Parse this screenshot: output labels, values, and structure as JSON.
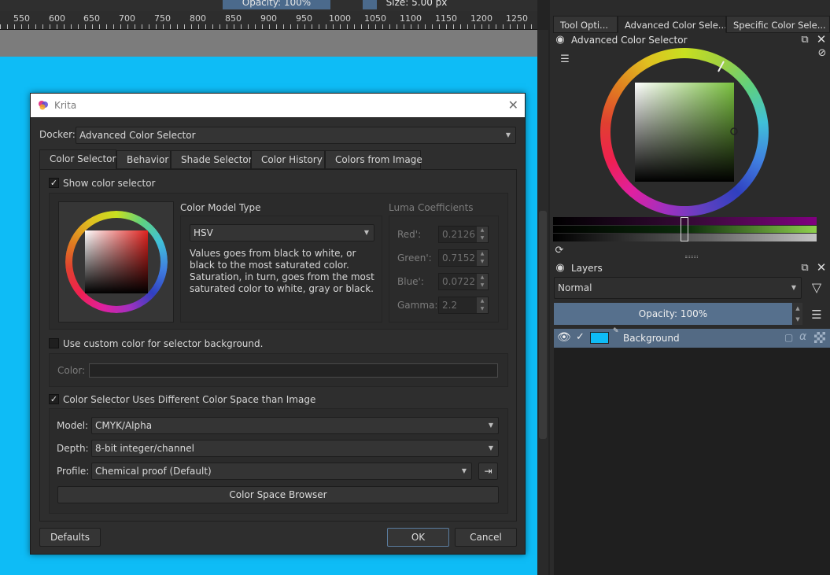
{
  "toolbar": {
    "opacity_label": "Opacity: 100%",
    "size_label": "Size: 5.00 px"
  },
  "ruler": {
    "ticks": [
      "550",
      "600",
      "650",
      "700",
      "750",
      "800",
      "850",
      "900",
      "950",
      "1000",
      "1050",
      "1100",
      "1150",
      "1200",
      "1250"
    ]
  },
  "dock": {
    "tabs": [
      "Tool Opti...",
      "Advanced Color Sele...",
      "Specific Color Sele..."
    ],
    "color_selector_title": "Advanced Color Selector",
    "layers_title": "Layers",
    "blend_mode": "Normal",
    "opacity": "Opacity:  100%",
    "layer_name": "Background"
  },
  "dialog": {
    "title": "Krita",
    "docker_label": "Docker:",
    "docker_value": "Advanced Color Selector",
    "tabs": [
      "Color Selector",
      "Behavior",
      "Shade Selector",
      "Color History",
      "Colors from Image"
    ],
    "show_selector": "Show color selector",
    "model_type_label": "Color Model Type",
    "model_type_value": "HSV",
    "model_desc": "Values goes from black to white, or black to the most saturated color. Saturation, in turn, goes from the most saturated color to white, gray or black.",
    "luma_label": "Luma Coefficients",
    "luma": [
      {
        "label": "Red':",
        "value": "0.2126"
      },
      {
        "label": "Green':",
        "value": "0.7152"
      },
      {
        "label": "Blue':",
        "value": "0.0722"
      },
      {
        "label": "Gamma:",
        "value": "2.2"
      }
    ],
    "custom_bg": "Use custom color for selector background.",
    "color_label": "Color:",
    "diff_space": "Color Selector Uses Different Color Space than Image",
    "model_label": "Model:",
    "model_value": "CMYK/Alpha",
    "depth_label": "Depth:",
    "depth_value": "8-bit integer/channel",
    "profile_label": "Profile:",
    "profile_value": "Chemical proof (Default)",
    "space_browser": "Color Space Browser",
    "defaults": "Defaults",
    "ok": "OK",
    "cancel": "Cancel"
  },
  "colors": {
    "canvas": "#0ebcf6",
    "accent": "#56708d",
    "selected_color": "#7ac13f",
    "preview_red": "#e0231f"
  }
}
